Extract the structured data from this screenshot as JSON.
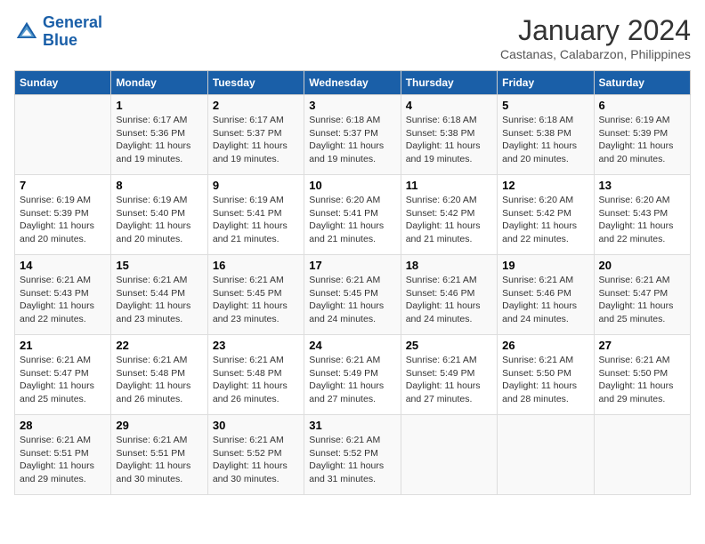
{
  "header": {
    "logo_line1": "General",
    "logo_line2": "Blue",
    "month": "January 2024",
    "location": "Castanas, Calabarzon, Philippines"
  },
  "days_of_week": [
    "Sunday",
    "Monday",
    "Tuesday",
    "Wednesday",
    "Thursday",
    "Friday",
    "Saturday"
  ],
  "weeks": [
    [
      {
        "day": "",
        "info": ""
      },
      {
        "day": "1",
        "info": "Sunrise: 6:17 AM\nSunset: 5:36 PM\nDaylight: 11 hours and 19 minutes."
      },
      {
        "day": "2",
        "info": "Sunrise: 6:17 AM\nSunset: 5:37 PM\nDaylight: 11 hours and 19 minutes."
      },
      {
        "day": "3",
        "info": "Sunrise: 6:18 AM\nSunset: 5:37 PM\nDaylight: 11 hours and 19 minutes."
      },
      {
        "day": "4",
        "info": "Sunrise: 6:18 AM\nSunset: 5:38 PM\nDaylight: 11 hours and 19 minutes."
      },
      {
        "day": "5",
        "info": "Sunrise: 6:18 AM\nSunset: 5:38 PM\nDaylight: 11 hours and 20 minutes."
      },
      {
        "day": "6",
        "info": "Sunrise: 6:19 AM\nSunset: 5:39 PM\nDaylight: 11 hours and 20 minutes."
      }
    ],
    [
      {
        "day": "7",
        "info": "Sunrise: 6:19 AM\nSunset: 5:39 PM\nDaylight: 11 hours and 20 minutes."
      },
      {
        "day": "8",
        "info": "Sunrise: 6:19 AM\nSunset: 5:40 PM\nDaylight: 11 hours and 20 minutes."
      },
      {
        "day": "9",
        "info": "Sunrise: 6:19 AM\nSunset: 5:41 PM\nDaylight: 11 hours and 21 minutes."
      },
      {
        "day": "10",
        "info": "Sunrise: 6:20 AM\nSunset: 5:41 PM\nDaylight: 11 hours and 21 minutes."
      },
      {
        "day": "11",
        "info": "Sunrise: 6:20 AM\nSunset: 5:42 PM\nDaylight: 11 hours and 21 minutes."
      },
      {
        "day": "12",
        "info": "Sunrise: 6:20 AM\nSunset: 5:42 PM\nDaylight: 11 hours and 22 minutes."
      },
      {
        "day": "13",
        "info": "Sunrise: 6:20 AM\nSunset: 5:43 PM\nDaylight: 11 hours and 22 minutes."
      }
    ],
    [
      {
        "day": "14",
        "info": "Sunrise: 6:21 AM\nSunset: 5:43 PM\nDaylight: 11 hours and 22 minutes."
      },
      {
        "day": "15",
        "info": "Sunrise: 6:21 AM\nSunset: 5:44 PM\nDaylight: 11 hours and 23 minutes."
      },
      {
        "day": "16",
        "info": "Sunrise: 6:21 AM\nSunset: 5:45 PM\nDaylight: 11 hours and 23 minutes."
      },
      {
        "day": "17",
        "info": "Sunrise: 6:21 AM\nSunset: 5:45 PM\nDaylight: 11 hours and 24 minutes."
      },
      {
        "day": "18",
        "info": "Sunrise: 6:21 AM\nSunset: 5:46 PM\nDaylight: 11 hours and 24 minutes."
      },
      {
        "day": "19",
        "info": "Sunrise: 6:21 AM\nSunset: 5:46 PM\nDaylight: 11 hours and 24 minutes."
      },
      {
        "day": "20",
        "info": "Sunrise: 6:21 AM\nSunset: 5:47 PM\nDaylight: 11 hours and 25 minutes."
      }
    ],
    [
      {
        "day": "21",
        "info": "Sunrise: 6:21 AM\nSunset: 5:47 PM\nDaylight: 11 hours and 25 minutes."
      },
      {
        "day": "22",
        "info": "Sunrise: 6:21 AM\nSunset: 5:48 PM\nDaylight: 11 hours and 26 minutes."
      },
      {
        "day": "23",
        "info": "Sunrise: 6:21 AM\nSunset: 5:48 PM\nDaylight: 11 hours and 26 minutes."
      },
      {
        "day": "24",
        "info": "Sunrise: 6:21 AM\nSunset: 5:49 PM\nDaylight: 11 hours and 27 minutes."
      },
      {
        "day": "25",
        "info": "Sunrise: 6:21 AM\nSunset: 5:49 PM\nDaylight: 11 hours and 27 minutes."
      },
      {
        "day": "26",
        "info": "Sunrise: 6:21 AM\nSunset: 5:50 PM\nDaylight: 11 hours and 28 minutes."
      },
      {
        "day": "27",
        "info": "Sunrise: 6:21 AM\nSunset: 5:50 PM\nDaylight: 11 hours and 29 minutes."
      }
    ],
    [
      {
        "day": "28",
        "info": "Sunrise: 6:21 AM\nSunset: 5:51 PM\nDaylight: 11 hours and 29 minutes."
      },
      {
        "day": "29",
        "info": "Sunrise: 6:21 AM\nSunset: 5:51 PM\nDaylight: 11 hours and 30 minutes."
      },
      {
        "day": "30",
        "info": "Sunrise: 6:21 AM\nSunset: 5:52 PM\nDaylight: 11 hours and 30 minutes."
      },
      {
        "day": "31",
        "info": "Sunrise: 6:21 AM\nSunset: 5:52 PM\nDaylight: 11 hours and 31 minutes."
      },
      {
        "day": "",
        "info": ""
      },
      {
        "day": "",
        "info": ""
      },
      {
        "day": "",
        "info": ""
      }
    ]
  ]
}
